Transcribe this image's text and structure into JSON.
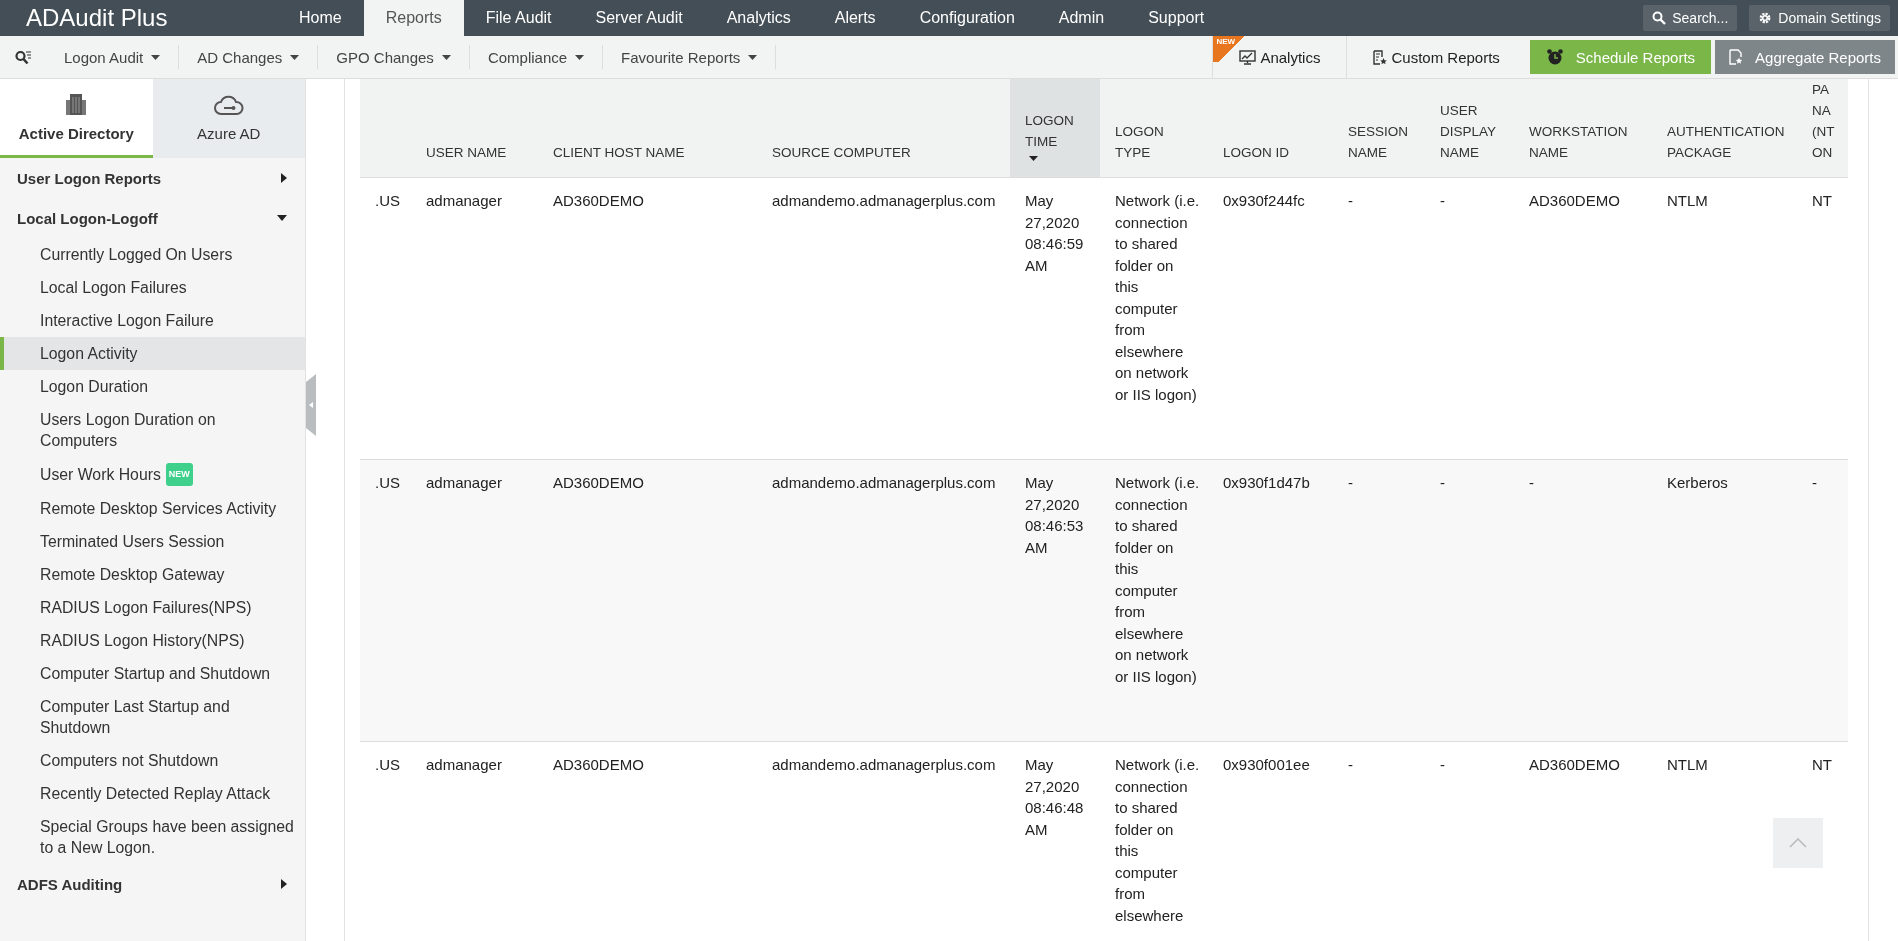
{
  "app": {
    "logo": "ADAudit Plus"
  },
  "top_nav": [
    {
      "label": "Home",
      "selected": false
    },
    {
      "label": "Reports",
      "selected": true
    },
    {
      "label": "File Audit",
      "selected": false
    },
    {
      "label": "Server Audit",
      "selected": false
    },
    {
      "label": "Analytics",
      "selected": false
    },
    {
      "label": "Alerts",
      "selected": false
    },
    {
      "label": "Configuration",
      "selected": false
    },
    {
      "label": "Admin",
      "selected": false
    },
    {
      "label": "Support",
      "selected": false
    }
  ],
  "top_actions": [
    {
      "kind": "search",
      "label": "Search..."
    },
    {
      "kind": "settings",
      "label": "Domain Settings"
    }
  ],
  "sub_nav": [
    {
      "label": "Logon Audit"
    },
    {
      "label": "AD Changes"
    },
    {
      "label": "GPO Changes"
    },
    {
      "label": "Compliance"
    },
    {
      "label": "Favourite Reports"
    }
  ],
  "toolbar_links": [
    {
      "kind": "analytics",
      "label": "Analytics",
      "badge": "NEW"
    },
    {
      "kind": "custom",
      "label": "Custom Reports"
    }
  ],
  "toolbar_buttons": [
    {
      "kind": "schedule",
      "label": "Schedule Reports"
    },
    {
      "kind": "aggregate",
      "label": "Aggregate Reports"
    }
  ],
  "sidebar": {
    "tabs": [
      {
        "kind": "directory",
        "label": "Active Directory",
        "selected": true
      },
      {
        "kind": "cloud",
        "label": "Azure AD",
        "selected": false
      }
    ],
    "groups": [
      {
        "label": "User Logon Reports",
        "expanded": false
      },
      {
        "label": "Local Logon-Logoff",
        "expanded": true,
        "children": [
          {
            "label": "Currently Logged On Users",
            "selected": false
          },
          {
            "label": "Local Logon Failures",
            "selected": false
          },
          {
            "label": "Interactive Logon Failure",
            "selected": false
          },
          {
            "label": "Logon Activity",
            "selected": true
          },
          {
            "label": "Logon Duration",
            "selected": false
          },
          {
            "label": "Users Logon Duration on Computers",
            "selected": false
          },
          {
            "label": "User Work Hours",
            "badge": "NEW",
            "selected": false
          },
          {
            "label": "Remote Desktop Services Activity",
            "selected": false
          },
          {
            "label": "Terminated Users Session",
            "selected": false
          },
          {
            "label": "Remote Desktop Gateway",
            "selected": false
          },
          {
            "label": "RADIUS Logon Failures(NPS)",
            "selected": false
          },
          {
            "label": "RADIUS Logon History(NPS)",
            "selected": false
          },
          {
            "label": "Computer Startup and Shutdown",
            "selected": false
          },
          {
            "label": "Computer Last Startup and Shutdown",
            "selected": false
          },
          {
            "label": "Computers not Shutdown",
            "selected": false
          },
          {
            "label": "Recently Detected Replay Attack",
            "selected": false
          },
          {
            "label": "Special Groups have been assigned to a New Logon.",
            "selected": false
          }
        ]
      },
      {
        "label": "ADFS Auditing",
        "expanded": false
      }
    ]
  },
  "table": {
    "columns": [
      {
        "sorted": false
      },
      {
        "label": "USER NAME",
        "sorted": false
      },
      {
        "label": "CLIENT HOST NAME",
        "sorted": false
      },
      {
        "label": "SOURCE COMPUTER",
        "sorted": false
      },
      {
        "label": "LOGON TIME",
        "sorted": true
      },
      {
        "label": "LOGON TYPE",
        "sorted": false
      },
      {
        "label": "LOGON ID",
        "sorted": false
      },
      {
        "label": "SESSION NAME",
        "sorted": false
      },
      {
        "label": "USER DISPLAY NAME",
        "sorted": false
      },
      {
        "label": "WORKSTATION NAME",
        "sorted": false
      },
      {
        "label": "AUTHENTICATION PACKAGE",
        "sorted": false
      },
      {
        "label": "PA NA (NT ON",
        "sorted": false
      }
    ],
    "rows": [
      [
        ".US",
        "admanager",
        "AD360DEMO",
        "admandemo.admanagerplus.com",
        "May 27,2020 08:46:59 AM",
        "Network (i.e. connection to shared folder on this computer from elsewhere on network or IIS logon)",
        "0x930f244fc",
        "-",
        "-",
        "AD360DEMO",
        "NTLM",
        "NT"
      ],
      [
        ".US",
        "admanager",
        "AD360DEMO",
        "admandemo.admanagerplus.com",
        "May 27,2020 08:46:53 AM",
        "Network (i.e. connection to shared folder on this computer from elsewhere on network or IIS logon)",
        "0x930f1d47b",
        "-",
        "-",
        "-",
        "Kerberos",
        "-"
      ],
      [
        ".US",
        "admanager",
        "AD360DEMO",
        "admandemo.admanagerplus.com",
        "May 27,2020 08:46:48 AM",
        "Network (i.e. connection to shared folder on this computer from elsewhere",
        "0x930f001ee",
        "-",
        "-",
        "AD360DEMO",
        "NTLM",
        "NT"
      ]
    ]
  }
}
